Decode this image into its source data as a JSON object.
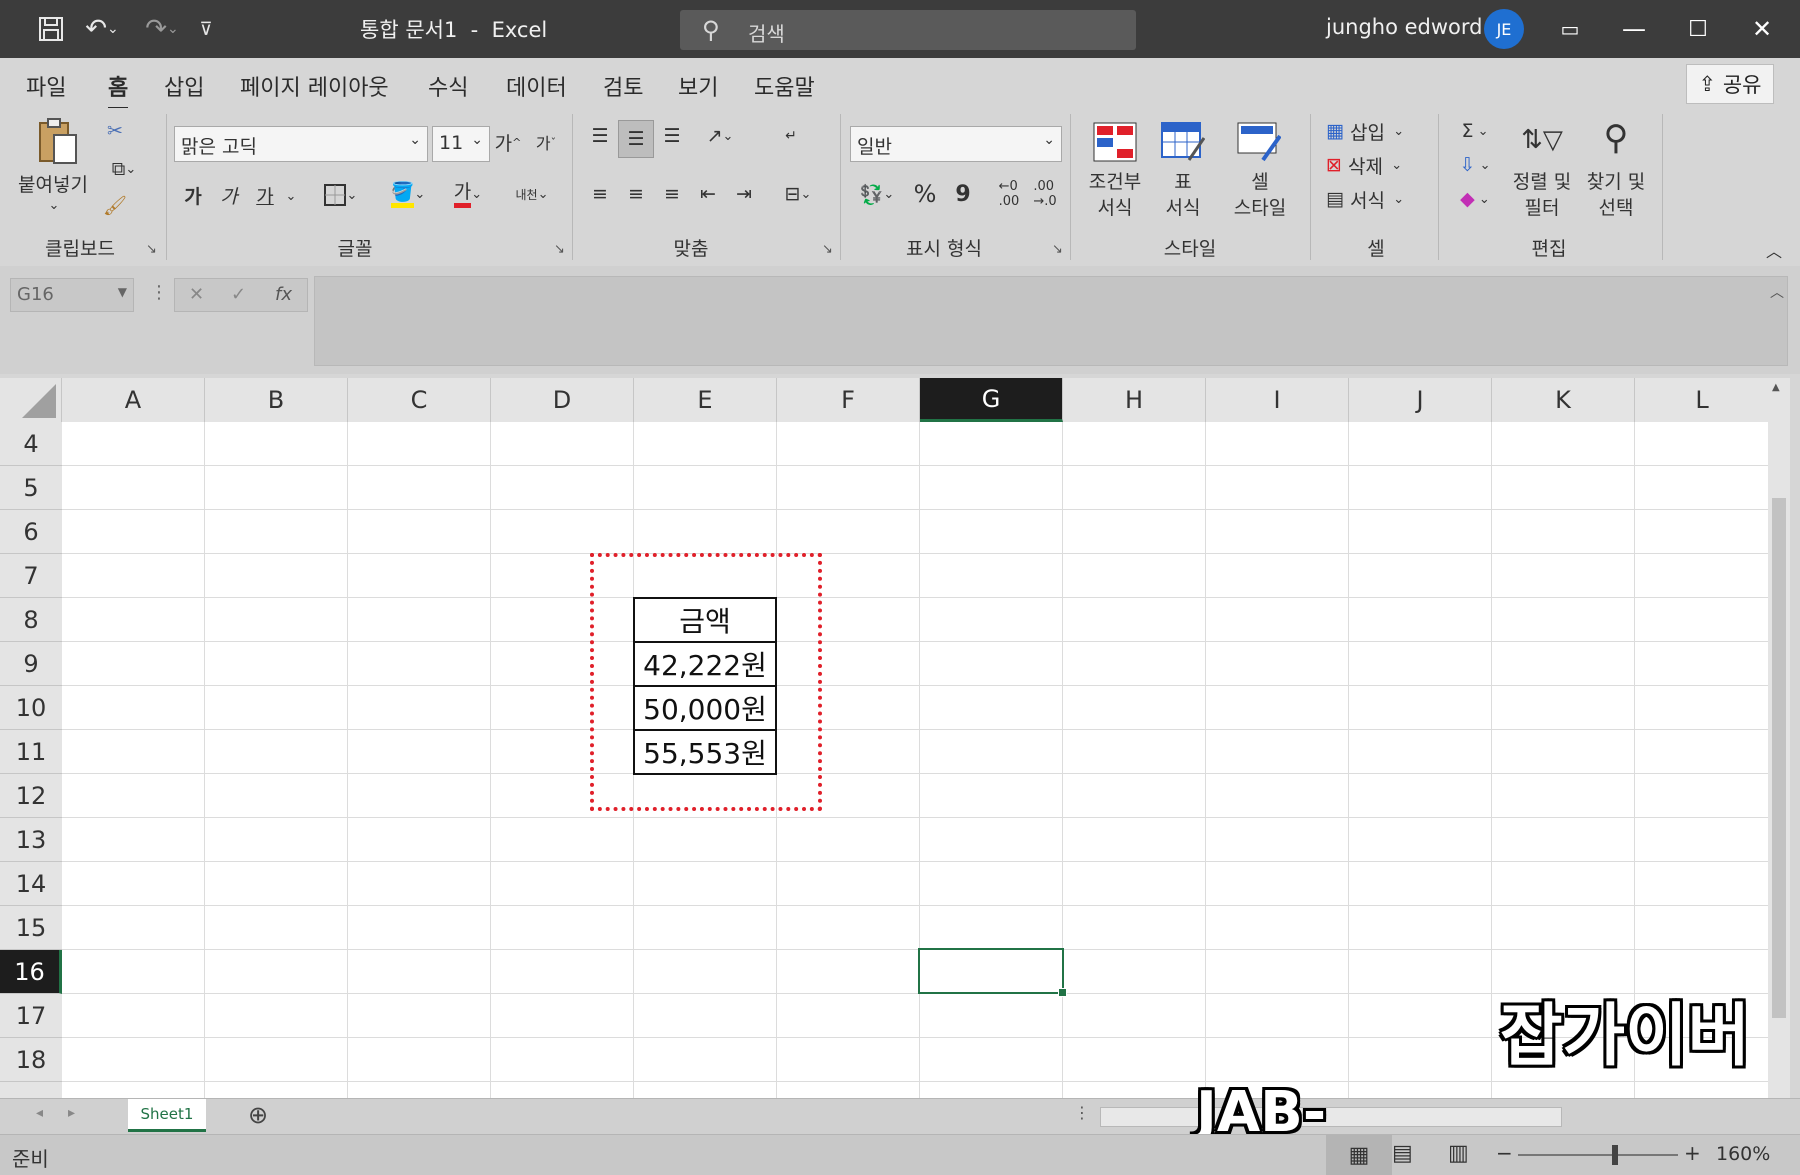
{
  "titlebar": {
    "title": "통합 문서1  -  Excel",
    "search_placeholder": "검색",
    "user_name": "jungho edword",
    "avatar_initials": "JE"
  },
  "tabs": [
    "파일",
    "홈",
    "삽입",
    "페이지 레이아웃",
    "수식",
    "데이터",
    "검토",
    "보기",
    "도움말"
  ],
  "active_tab": "홈",
  "share_label": "공유",
  "ribbon": {
    "clipboard": {
      "paste_label": "붙여넣기",
      "group_label": "클립보드"
    },
    "font": {
      "font_name": "맑은 고딕",
      "font_size": "11",
      "bold": "가",
      "italic": "가",
      "underline": "가",
      "font_color": "가",
      "group_label": "글꼴"
    },
    "alignment": {
      "group_label": "맞춤"
    },
    "number": {
      "format": "일반",
      "percent": "%",
      "comma": "9",
      "group_label": "표시 형식"
    },
    "styles": {
      "conditional_format": "조건부\n서식",
      "table_format": "표\n서식",
      "cell_styles": "셀\n스타일",
      "group_label": "스타일"
    },
    "cells": {
      "insert": "삽입",
      "delete": "삭제",
      "format": "서식",
      "group_label": "셀"
    },
    "editing": {
      "sort_filter": "정렬 및\n필터",
      "find_select": "찾기 및\n선택",
      "group_label": "편집"
    }
  },
  "formula_bar": {
    "name_box": "G16",
    "formula": ""
  },
  "columns": [
    "A",
    "B",
    "C",
    "D",
    "E",
    "F",
    "G",
    "H",
    "I",
    "J",
    "K",
    "L"
  ],
  "selected_column": "G",
  "rows": [
    "4",
    "5",
    "6",
    "7",
    "8",
    "9",
    "10",
    "11",
    "12",
    "13",
    "14",
    "15",
    "16",
    "17",
    "18"
  ],
  "selected_row": "16",
  "table": {
    "header": "금액",
    "values": [
      "42,222원",
      "50,000원",
      "55,553원"
    ]
  },
  "sheet_tab": "Sheet1",
  "status": {
    "ready": "준비",
    "zoom": "160%"
  },
  "watermark": {
    "korean": "잡가이버",
    "url": "JAB-GUYVER.CO.KR"
  },
  "colors": {
    "accent": "#217346",
    "highlight": "#e0202a",
    "titlebar": "#3c3c3c"
  }
}
